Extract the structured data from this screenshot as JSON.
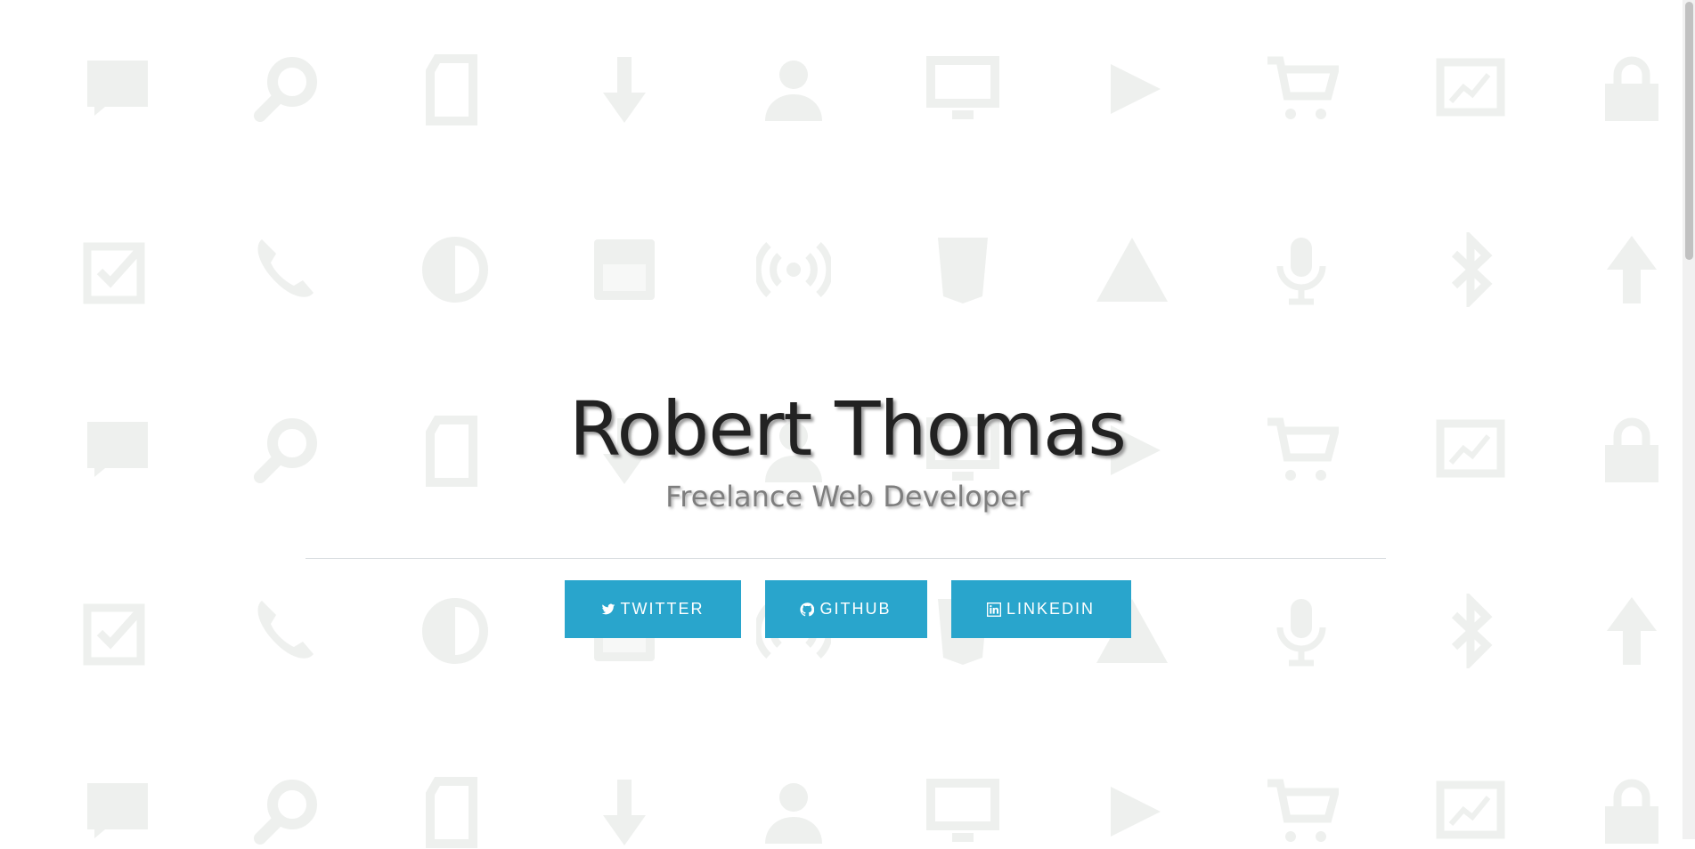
{
  "hero": {
    "name": "Robert Thomas",
    "role": "Freelance Web Developer"
  },
  "social_buttons": [
    {
      "label": "TWITTER",
      "icon": "twitter-icon"
    },
    {
      "label": "GITHUB",
      "icon": "github-icon"
    },
    {
      "label": "LINKEDIN",
      "icon": "linkedin-icon"
    }
  ],
  "background_pattern": {
    "color": "#eef0ee",
    "icons_row_a": [
      "comment-icon",
      "search-icon",
      "file-icon",
      "arrow-down-icon",
      "user-icon",
      "monitor-icon",
      "play-icon",
      "cart-icon",
      "chart-icon",
      "lock-icon"
    ],
    "icons_row_b": [
      "checkbox-edit-icon",
      "phone-icon",
      "contrast-icon",
      "calendar-icon",
      "broadcast-icon",
      "html5-icon",
      "warning-icon",
      "microphone-icon",
      "bluetooth-icon",
      "arrow-up-icon"
    ]
  },
  "colors": {
    "button_bg": "#29a5cc",
    "button_text": "#ffffff",
    "name_text": "#222222",
    "role_text": "#7e7e7e"
  }
}
